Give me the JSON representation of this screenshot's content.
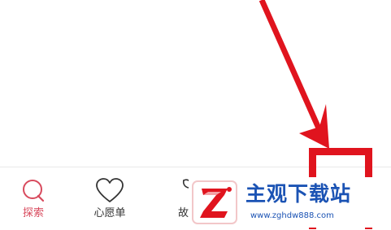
{
  "colors": {
    "accent": "#d84a5d",
    "text": "#333333",
    "annotation_red": "#e0141e",
    "watermark_blue": "#1b53b4"
  },
  "tab_bar": {
    "tabs": [
      {
        "label": "探索",
        "icon": "search-icon",
        "active": true
      },
      {
        "label": "心愿单",
        "icon": "heart-icon",
        "active": false
      },
      {
        "label": "故",
        "icon": "story-icon",
        "active": false
      }
    ]
  },
  "watermark": {
    "title": "主观下载站",
    "url": "www.zghdw888.com"
  }
}
